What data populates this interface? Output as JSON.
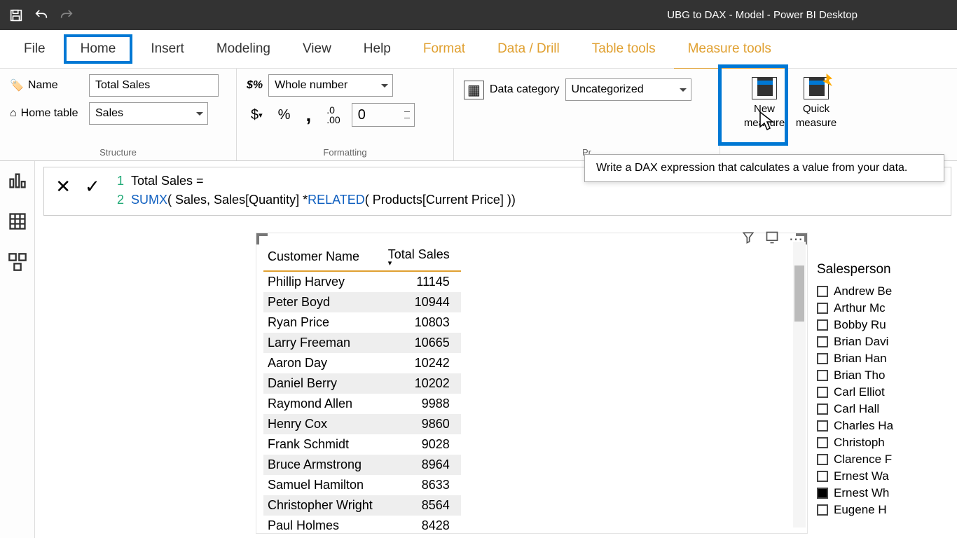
{
  "window": {
    "title": "UBG to DAX - Model - Power BI Desktop"
  },
  "tabs": [
    "File",
    "Home",
    "Insert",
    "Modeling",
    "View",
    "Help",
    "Format",
    "Data / Drill",
    "Table tools",
    "Measure tools"
  ],
  "ribbon": {
    "structure": {
      "name_label": "Name",
      "name_value": "Total Sales",
      "home_table_label": "Home table",
      "home_table_value": "Sales",
      "group_label": "Structure"
    },
    "formatting": {
      "format_value": "Whole number",
      "decimal_value": "0",
      "group_label": "Formatting",
      "sym_dollar": "$",
      "sym_percent": "%",
      "sym_comma": ","
    },
    "properties": {
      "data_category_label": "Data category",
      "data_category_value": "Uncategorized",
      "group_label": "Pr"
    },
    "calculations": {
      "new_measure": "New measure",
      "quick_measure": "Quick measure"
    }
  },
  "tooltip": "Write a DAX expression that calculates a value from your data.",
  "formula": {
    "line1": "Total Sales =",
    "line2_kw1": "SUMX",
    "line2_mid": "( Sales, Sales[Quantity] * ",
    "line2_kw2": "RELATED",
    "line2_end": "( Products[Current Price] ))"
  },
  "table": {
    "cols": [
      "Customer Name",
      "Total Sales"
    ],
    "rows": [
      {
        "name": "Phillip Harvey",
        "val": "11145"
      },
      {
        "name": "Peter Boyd",
        "val": "10944"
      },
      {
        "name": "Ryan Price",
        "val": "10803"
      },
      {
        "name": "Larry Freeman",
        "val": "10665"
      },
      {
        "name": "Aaron Day",
        "val": "10242"
      },
      {
        "name": "Daniel Berry",
        "val": "10202"
      },
      {
        "name": "Raymond Allen",
        "val": "9988"
      },
      {
        "name": "Henry Cox",
        "val": "9860"
      },
      {
        "name": "Frank Schmidt",
        "val": "9028"
      },
      {
        "name": "Bruce Armstrong",
        "val": "8964"
      },
      {
        "name": "Samuel Hamilton",
        "val": "8633"
      },
      {
        "name": "Christopher Wright",
        "val": "8564"
      },
      {
        "name": "Paul Holmes",
        "val": "8428"
      }
    ]
  },
  "filter": {
    "header": "Salesperson",
    "items": [
      {
        "label": "Andrew Be",
        "checked": false
      },
      {
        "label": "Arthur Mc",
        "checked": false
      },
      {
        "label": "Bobby Ru",
        "checked": false
      },
      {
        "label": "Brian Davi",
        "checked": false
      },
      {
        "label": "Brian Han",
        "checked": false
      },
      {
        "label": "Brian Tho",
        "checked": false
      },
      {
        "label": "Carl Elliot",
        "checked": false
      },
      {
        "label": "Carl Hall",
        "checked": false
      },
      {
        "label": "Charles Ha",
        "checked": false
      },
      {
        "label": "Christoph",
        "checked": false
      },
      {
        "label": "Clarence F",
        "checked": false
      },
      {
        "label": "Ernest Wa",
        "checked": false
      },
      {
        "label": "Ernest Wh",
        "checked": true
      },
      {
        "label": "Eugene H",
        "checked": false
      }
    ]
  }
}
